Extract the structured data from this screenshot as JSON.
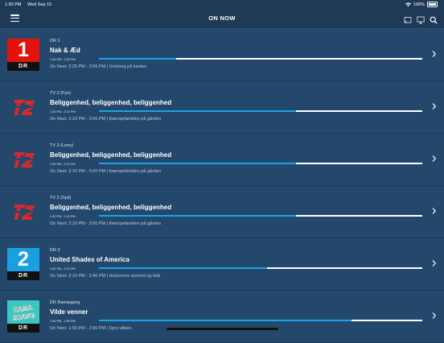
{
  "status": {
    "time": "1:50 PM",
    "date": "Wed Sep 15",
    "battery": "100%"
  },
  "header": {
    "title": "ON NOW"
  },
  "rows": [
    {
      "logo": "dr1",
      "logo_top": "1",
      "logo_bottom": "DR",
      "logo_color": "#e3120b",
      "channel": "DR 1",
      "program": "Nak & Æd",
      "slot": "1:40 PM - 2:25 PM",
      "progress": 0.24,
      "next": "On Next: 2:25 PM - 2:55 PM | Grisberg på kanten"
    },
    {
      "logo": "tv2",
      "channel": "TV 2 (Fyn)",
      "program": "Beliggenhed, beliggenhed, beliggenhed",
      "slot": "1:20 PM - 2:10 PM",
      "progress": 0.61,
      "next": "On Next: 2:10 PM - 3:00 PM | Kæmpefamilien på gården"
    },
    {
      "logo": "tv2",
      "channel": "TV 2 (Lorry)",
      "program": "Beliggenhed, beliggenhed, beliggenhed",
      "slot": "1:20 PM - 2:10 PM",
      "progress": 0.61,
      "next": "On Next: 2:10 PM - 3:00 PM | Kæmpefamilien på gården"
    },
    {
      "logo": "tv2",
      "channel": "TV 2 (Syd)",
      "program": "Beliggenhed, beliggenhed, beliggenhed",
      "slot": "1:20 PM - 2:10 PM",
      "progress": 0.61,
      "next": "On Next: 2:10 PM - 3:00 PM | Kæmpefamilien på gården"
    },
    {
      "logo": "dr2",
      "logo_top": "2",
      "logo_bottom": "DR",
      "logo_color": "#1aa0e0",
      "channel": "DR 2",
      "program": "United Shades of America",
      "slot": "1:30 PM - 2:10 PM",
      "progress": 0.52,
      "next": "On Next: 2:10 PM - 2:40 PM | Humorens storhed og fald"
    },
    {
      "logo": "ramasjang",
      "logo_top": "RAMASJANG",
      "logo_bottom": "DR",
      "logo_color": "#39c8c0",
      "channel": "DR Ramasjang",
      "program": "Vilde venner",
      "slot": "1:35 PM - 1:55 PM",
      "progress": 0.78,
      "next": "On Next: 1:55 PM - 2:00 PM | Dyrs våben"
    }
  ],
  "icons": [
    "hamburger-icon",
    "cast-icon",
    "airplay-icon",
    "search-icon",
    "chevron-right-icon",
    "wifi-icon",
    "battery-icon"
  ]
}
